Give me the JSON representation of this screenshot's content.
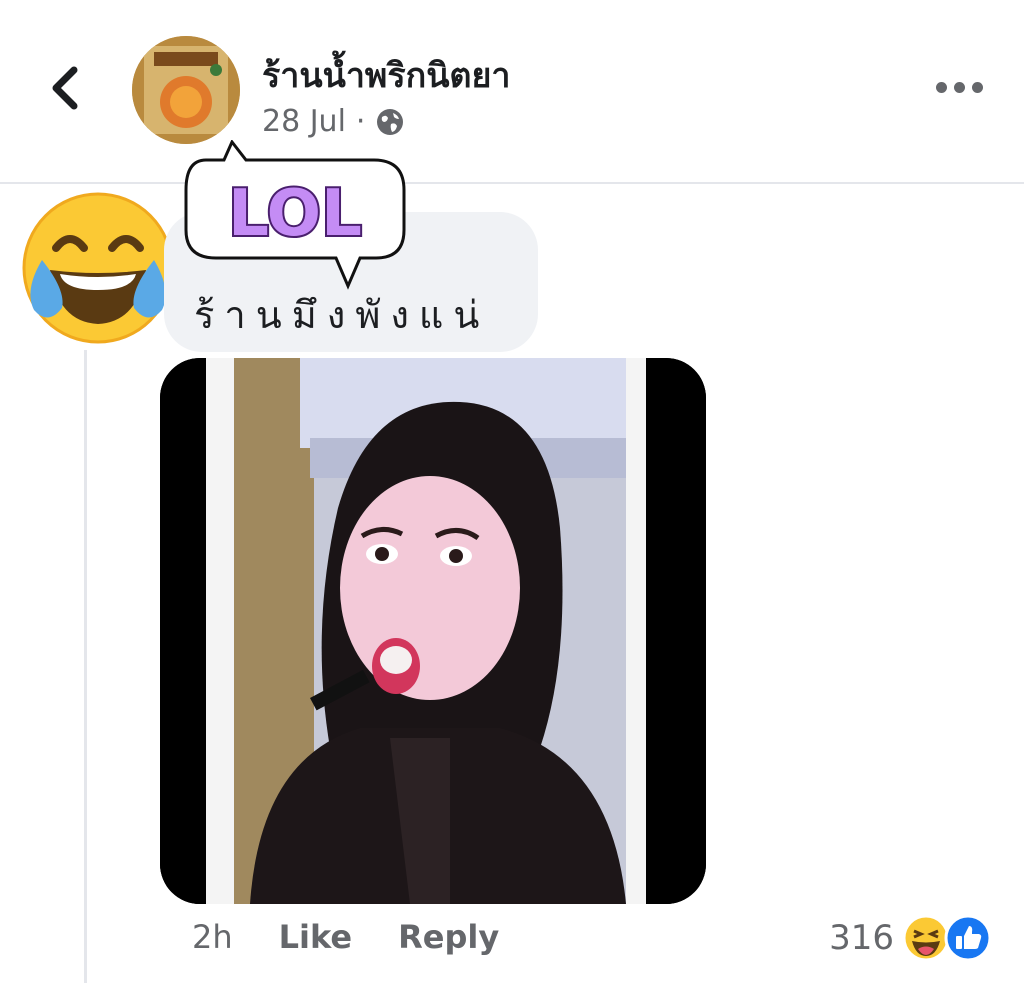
{
  "header": {
    "page_name": "ร้านน้ำพริกนิตยา",
    "date": "28 Jul",
    "separator": "·",
    "icons": [
      "back-chevron-icon",
      "globe-icon",
      "more-dots-icon"
    ]
  },
  "comment": {
    "text": "ร้านมึงพังแน่",
    "sticker_text": "LOL",
    "avatar_emoji": "face-with-tears-of-joy",
    "time": "2h",
    "like_label": "Like",
    "reply_label": "Reply",
    "reaction_count": "316",
    "reaction_icons": [
      "haha-reaction-icon",
      "like-reaction-icon"
    ]
  },
  "colors": {
    "text": "#1c1e21",
    "secondary": "#65676b",
    "bubble": "#f0f2f5",
    "like_blue": "#1877f2",
    "sticker_purple": "#c48cf5"
  }
}
